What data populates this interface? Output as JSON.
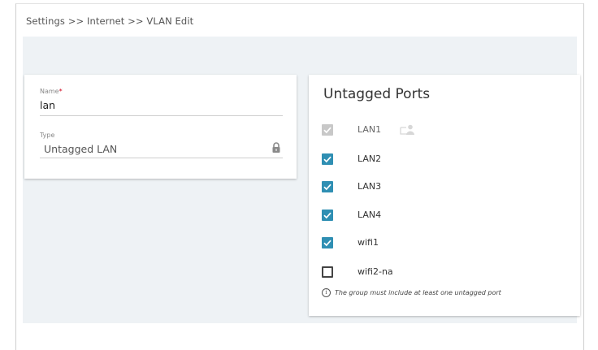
{
  "breadcrumb": "Settings >> Internet >> VLAN Edit",
  "form": {
    "name_label": "Name",
    "name_required_mark": "*",
    "name_value": "lan",
    "type_label": "Type",
    "type_value": "Untagged LAN"
  },
  "ports": {
    "title": "Untagged Ports",
    "items": [
      {
        "label": "LAN1",
        "checked": true,
        "disabled": true,
        "icon": "user-icon"
      },
      {
        "label": "LAN2",
        "checked": true,
        "disabled": false
      },
      {
        "label": "LAN3",
        "checked": true,
        "disabled": false
      },
      {
        "label": "LAN4",
        "checked": true,
        "disabled": false
      },
      {
        "label": "wifi1",
        "checked": true,
        "disabled": false
      },
      {
        "label": "wifi2-na",
        "checked": false,
        "disabled": false
      }
    ],
    "hint": "The group must include at least one untagged port",
    "hint_icon": "i"
  },
  "colors": {
    "accent": "#2f8fb3",
    "background": "#eef2f5",
    "required": "#d0021b"
  }
}
